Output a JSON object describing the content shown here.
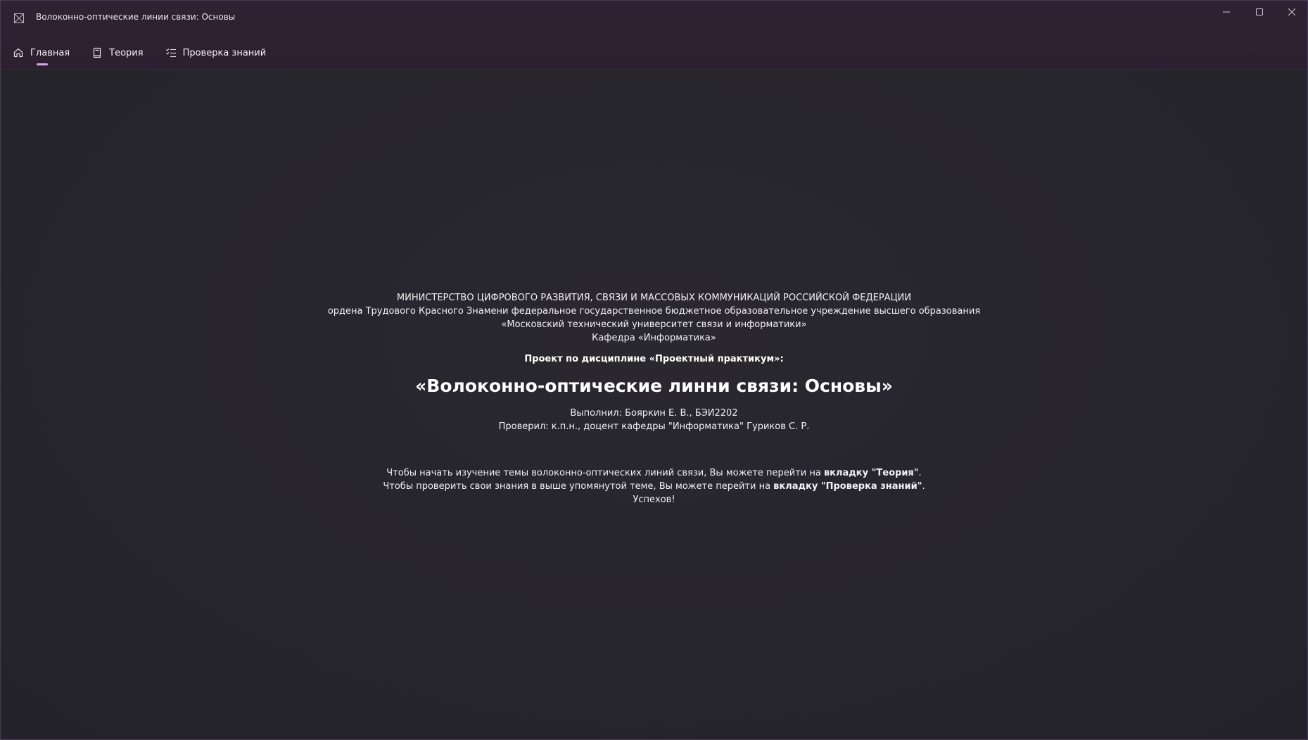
{
  "window": {
    "title": "Волоконно-оптические линии связи: Основы",
    "accent_color": "#d7a7e8",
    "icons": {
      "app": "app-icon",
      "minimize": "minimize-icon",
      "maximize": "maximize-icon",
      "close": "close-icon"
    }
  },
  "nav": {
    "items": [
      {
        "label": "Главная",
        "icon": "home-icon",
        "active": true
      },
      {
        "label": "Теория",
        "icon": "book-icon",
        "active": false
      },
      {
        "label": "Проверка знаний",
        "icon": "checklist-icon",
        "active": false
      }
    ]
  },
  "main": {
    "header_lines": [
      "МИНИСТЕРСТВО ЦИФРОВОГО РАЗВИТИЯ, СВЯЗИ И МАССОВЫХ КОММУНИКАЦИЙ РОССИЙСКОЙ ФЕДЕРАЦИИ",
      "ордена Трудового Красного Знамени федеральное государственное бюджетное образовательное учреждение высшего образования",
      "«Московский технический университет связи и информатики»",
      "Кафедра «Информатика»"
    ],
    "project_line": "Проект по дисциплине «Проектный практикум»:",
    "title": "«Волоконно-оптические линни связи: Основы»",
    "performed_by": "Выполнил: Бояркин Е. В., БЭИ2202",
    "checked_by": "Проверил: к.п.н., доцент кафедры \"Информатика\" Гуриков С. Р.",
    "instruction1": {
      "text": "Чтобы начать изучение темы волоконно-оптических линий связи, Вы можете перейти на ",
      "bold": "вкладку \"Теория\"",
      "end": "."
    },
    "instruction2": {
      "text": "Чтобы проверить свои знания в выше упомянутой теме, Вы можете перейти на ",
      "bold": "вкладку \"Проверка знаний\"",
      "end": "."
    },
    "closing": "Успехов!"
  }
}
